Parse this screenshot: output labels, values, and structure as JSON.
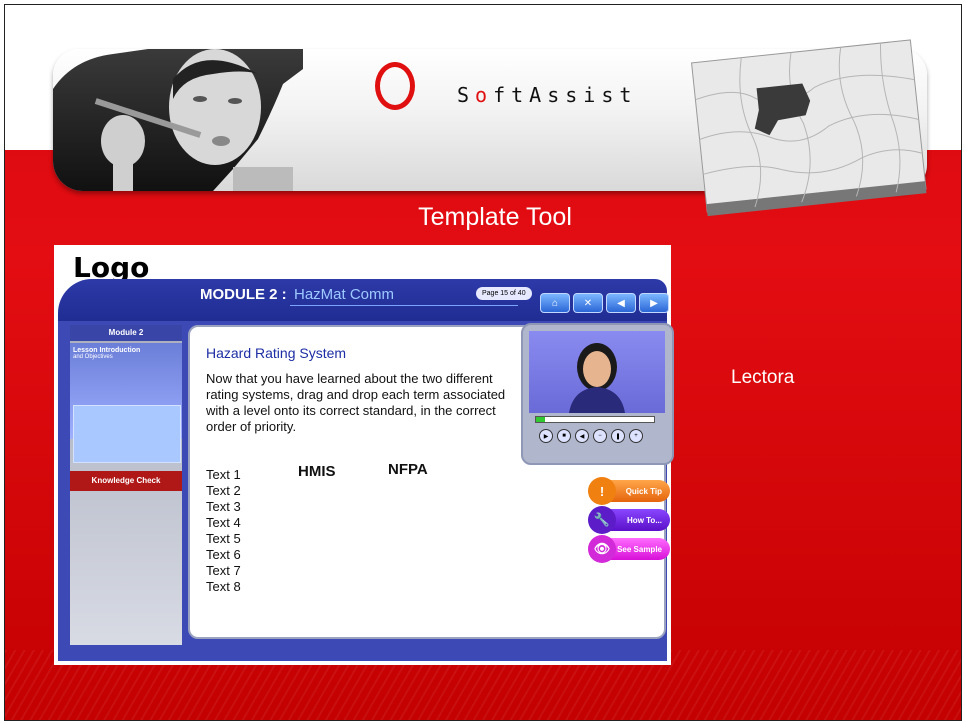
{
  "slide": {
    "title": "Template Tool",
    "side_label": "Lectora",
    "colors": {
      "background_red": "#d80a10",
      "banner_white": "#ffffff"
    }
  },
  "banner": {
    "brand_prefix": "S",
    "brand_o": "o",
    "brand_suffix": "ftAssist",
    "icons": [
      "woman-with-pen-photo",
      "red-ring-logo",
      "puzzle-pieces-image"
    ]
  },
  "course": {
    "logo": "Logo",
    "module_label": "MODULE 2 :",
    "module_name": "HazMat Comm",
    "page_indicator": "Page 15 of 40",
    "nav_icons": [
      "home-icon",
      "close-icon",
      "back-icon",
      "forward-icon"
    ],
    "sidebar": {
      "title": "Module 2",
      "items": [
        {
          "label": "Lesson Introduction",
          "sub": "and Objectives"
        },
        {
          "label": "Knowledge Check"
        }
      ]
    },
    "content": {
      "heading": "Hazard Rating System",
      "paragraph": "Now that you have learned about the two different rating systems, drag and drop each term associated with a level onto its correct standard, in the correct order of priority.",
      "text_items": [
        "Text 1",
        "Text 2",
        "Text 3",
        "Text 4",
        "Text 5",
        "Text 6",
        "Text 7",
        "Text 8"
      ],
      "target_labels": [
        "HMIS",
        "NFPA"
      ]
    },
    "video": {
      "progress": 0.08
    },
    "actions": [
      {
        "label": "Quick Tip",
        "icon": "exclamation-icon"
      },
      {
        "label": "How To...",
        "icon": "wrench-icon"
      },
      {
        "label": "See Sample",
        "icon": "eye-icon"
      }
    ]
  }
}
